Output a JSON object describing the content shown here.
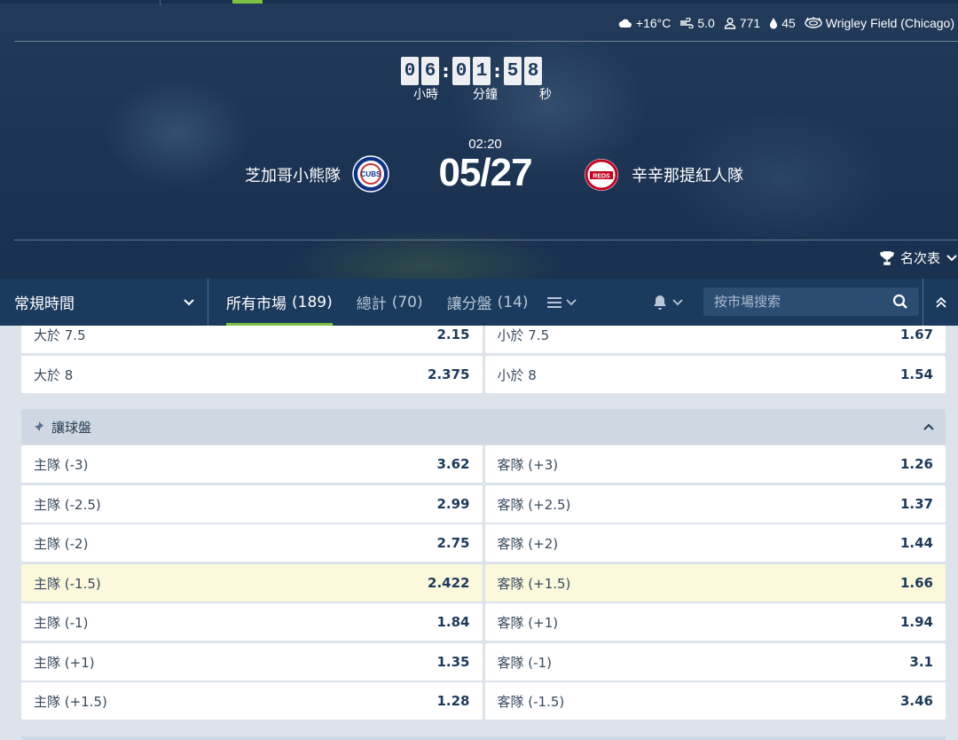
{
  "weather": {
    "temperature": "+16°C",
    "wind": "5.0",
    "attendance": "771",
    "humidity": "45",
    "venue": "Wrigley Field (Chicago)"
  },
  "countdown": {
    "digits": [
      "0",
      "6",
      "0",
      "1",
      "5",
      "8"
    ],
    "hours_label": "小時",
    "minutes_label": "分鐘",
    "seconds_label": "秒"
  },
  "match": {
    "time": "02:20",
    "date": "05/27",
    "home_team": "芝加哥小熊隊",
    "away_team": "辛辛那提紅人隊",
    "home_logo_text": "CUBS",
    "away_logo_text": "REDS"
  },
  "standings_label": "名次表",
  "nav": {
    "period": "常規時間",
    "tabs": [
      {
        "label": "所有市場",
        "count": "(189)"
      },
      {
        "label": "總計",
        "count": "(70)"
      },
      {
        "label": "讓分盤",
        "count": "(14)"
      }
    ],
    "search_placeholder": "按市場搜索"
  },
  "totals_rows": [
    {
      "left_label": "大於 7.5",
      "left_odds": "2.15",
      "right_label": "小於 7.5",
      "right_odds": "1.67"
    },
    {
      "left_label": "大於 8",
      "left_odds": "2.375",
      "right_label": "小於 8",
      "right_odds": "1.54"
    }
  ],
  "handicap_group": {
    "title": "讓球盤",
    "rows": [
      {
        "left_label": "主隊 (-3)",
        "left_odds": "3.62",
        "right_label": "客隊 (+3)",
        "right_odds": "1.26"
      },
      {
        "left_label": "主隊 (-2.5)",
        "left_odds": "2.99",
        "right_label": "客隊 (+2.5)",
        "right_odds": "1.37"
      },
      {
        "left_label": "主隊 (-2)",
        "left_odds": "2.75",
        "right_label": "客隊 (+2)",
        "right_odds": "1.44"
      },
      {
        "left_label": "主隊 (-1.5)",
        "left_odds": "2.422",
        "right_label": "客隊 (+1.5)",
        "right_odds": "1.66"
      },
      {
        "left_label": "主隊 (-1)",
        "left_odds": "1.84",
        "right_label": "客隊 (+1)",
        "right_odds": "1.94"
      },
      {
        "left_label": "主隊 (+1)",
        "left_odds": "1.35",
        "right_label": "客隊 (-1)",
        "right_odds": "3.1"
      },
      {
        "left_label": "主隊 (+1.5)",
        "left_odds": "1.28",
        "right_label": "客隊 (-1.5)",
        "right_odds": "3.46"
      }
    ]
  },
  "colors": {
    "accent": "#7cc242",
    "nav_bg": "#1a3a5e",
    "highlight_row": "#fbf8dc"
  }
}
